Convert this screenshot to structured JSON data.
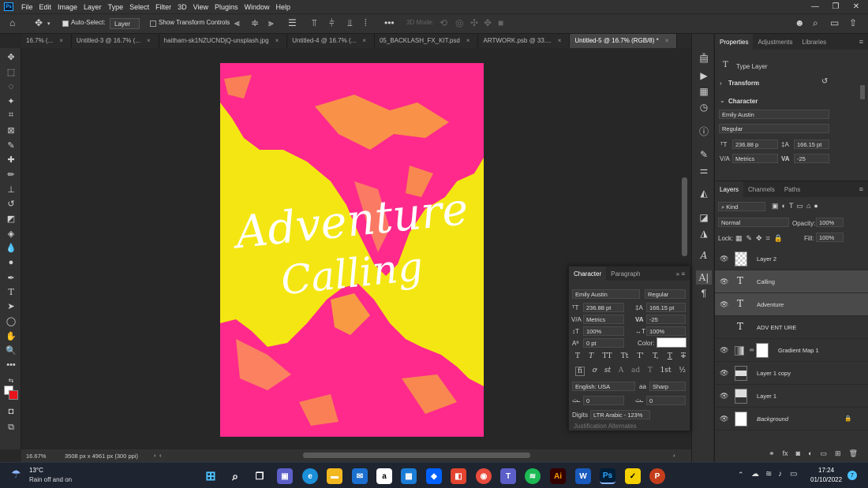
{
  "app": {
    "logo": "Ps",
    "menu": [
      "File",
      "Edit",
      "Image",
      "Layer",
      "Type",
      "Select",
      "Filter",
      "3D",
      "View",
      "Plugins",
      "Window",
      "Help"
    ]
  },
  "options_bar": {
    "auto_select_label": "Auto-Select:",
    "auto_select_value": "Layer",
    "transform_controls_label": "Show Transform Controls",
    "mode_3d_label": "3D Mode:"
  },
  "tabs": [
    "16.7% (...",
    "Untitled-3 @ 16.7% (...",
    "haitham-sk1NZUCNDjQ-unsplash.jpg",
    "Untitled-4 @ 16.7% (...",
    "05_BACKLASH_FX_KIT.psd",
    "ARTWORK.psb @ 33....",
    "Untitled-5 @ 16.7% (RGB/8) *"
  ],
  "poster": {
    "line1": "Adventure",
    "line2": "Calling",
    "colors": {
      "background": "#f4e613",
      "accent": "#ff2a8c"
    }
  },
  "status": {
    "zoom": "16.67%",
    "doc_info": "3508 px x 4961 px (300 ppi)"
  },
  "properties": {
    "tabs": [
      "Properties",
      "Adjustments",
      "Libraries"
    ],
    "layer_type": "Type Layer",
    "transform_label": "Transform",
    "character_label": "Character",
    "font": "Emily Austin",
    "style": "Regular",
    "size": "236.88 p",
    "leading": "166.15 pt",
    "kerning": "Metrics",
    "tracking": "-25"
  },
  "layers": {
    "tabs": [
      "Layers",
      "Channels",
      "Paths"
    ],
    "filter_kind": "Kind",
    "blend_mode": "Normal",
    "opacity_label": "Opacity:",
    "opacity": "100%",
    "lock_label": "Lock:",
    "fill_label": "Fill:",
    "fill": "100%",
    "items": [
      {
        "name": "Layer 2",
        "kind": "pixel",
        "visible": true,
        "selected": false
      },
      {
        "name": "Calling",
        "kind": "type",
        "visible": true,
        "selected": true
      },
      {
        "name": "Adventure",
        "kind": "type",
        "visible": true,
        "selected": true
      },
      {
        "name": "ADV ENT URE",
        "kind": "type",
        "visible": false,
        "selected": false
      },
      {
        "name": "Gradient Map 1",
        "kind": "adjustment",
        "visible": true,
        "selected": false
      },
      {
        "name": "Layer 1 copy",
        "kind": "pixel",
        "visible": true,
        "selected": false
      },
      {
        "name": "Layer 1",
        "kind": "pixel",
        "visible": true,
        "selected": false
      },
      {
        "name": "Background",
        "kind": "background",
        "visible": true,
        "selected": false
      }
    ]
  },
  "character_panel": {
    "tabs": [
      "Character",
      "Paragraph"
    ],
    "font": "Emily Austin",
    "style": "Regular",
    "size": "236.88 pt",
    "leading": "166.15 pt",
    "kerning": "Metrics",
    "tracking": "-25",
    "vscale": "100%",
    "hscale": "100%",
    "baseline": "0 pt",
    "color_label": "Color:",
    "type_buttons": [
      "T",
      "T",
      "TT",
      "Tt",
      "T'",
      "T,",
      "T",
      "T"
    ],
    "opentype_buttons": [
      "fi",
      "ơ",
      "st",
      "A",
      "ad",
      "T",
      "1st",
      "½"
    ],
    "language": "English: USA",
    "antialias_icon": "aa",
    "antialias": "Sharp",
    "field_a": "0",
    "field_b": "0",
    "digits_label": "Digits",
    "digits": "LTR Arabic - 123%",
    "justification": "Justification Alternates"
  },
  "taskbar": {
    "temperature": "13°C",
    "weather": "Rain off and on",
    "time": "17:24",
    "date": "01/10/2022",
    "notification_count": "7"
  }
}
